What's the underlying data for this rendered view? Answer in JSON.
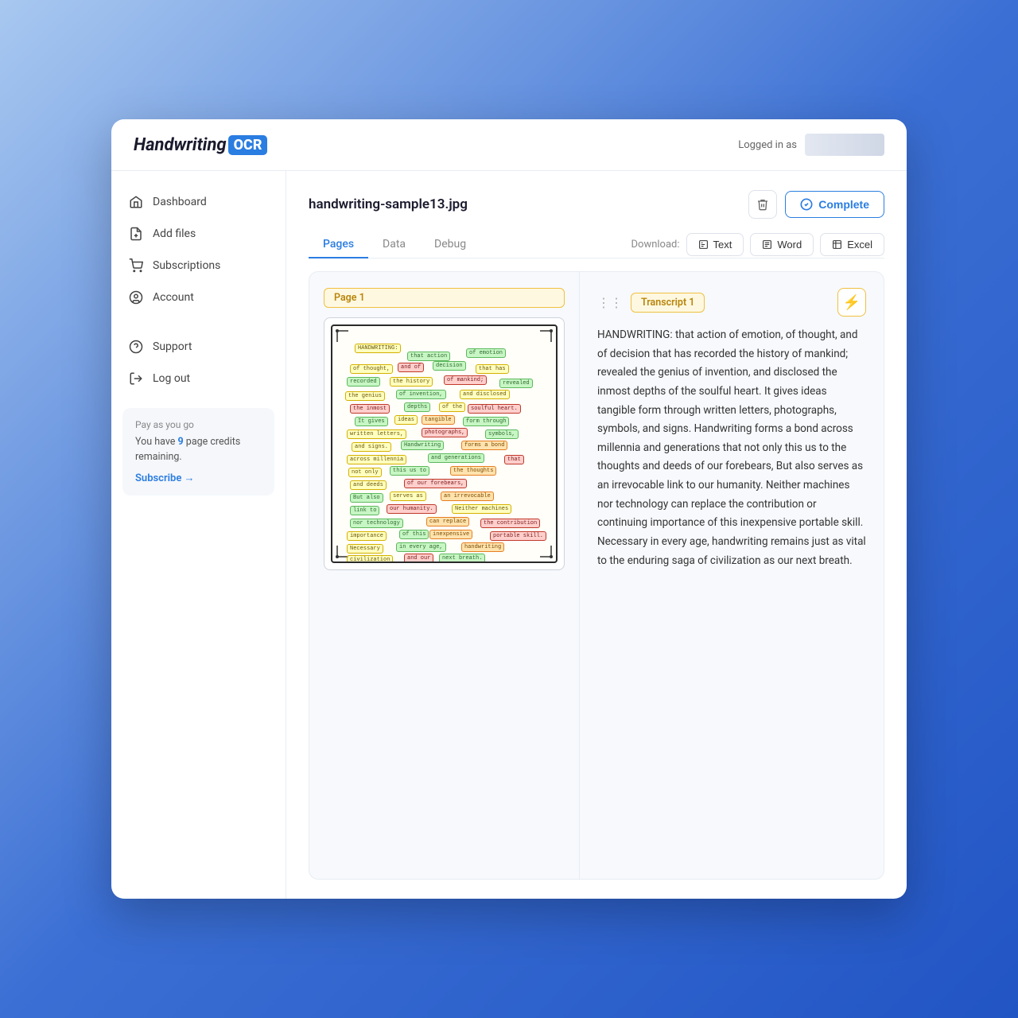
{
  "app": {
    "logo_text": "Handwriting",
    "logo_ocr": "OCR",
    "logged_in_label": "Logged in as"
  },
  "sidebar": {
    "items": [
      {
        "id": "dashboard",
        "label": "Dashboard",
        "icon": "home"
      },
      {
        "id": "add-files",
        "label": "Add files",
        "icon": "file-plus"
      },
      {
        "id": "subscriptions",
        "label": "Subscriptions",
        "icon": "shopping-cart"
      },
      {
        "id": "account",
        "label": "Account",
        "icon": "user-circle"
      },
      {
        "id": "support",
        "label": "Support",
        "icon": "help-circle"
      },
      {
        "id": "logout",
        "label": "Log out",
        "icon": "log-out"
      }
    ],
    "credits": {
      "title": "Pay as you go",
      "text_prefix": "You have ",
      "credits_count": "9",
      "text_suffix": " page credits remaining.",
      "subscribe_label": "Subscribe →"
    }
  },
  "file": {
    "name": "handwriting-sample13.jpg",
    "complete_label": "Complete",
    "delete_title": "Delete"
  },
  "tabs": [
    {
      "id": "pages",
      "label": "Pages",
      "active": true
    },
    {
      "id": "data",
      "label": "Data"
    },
    {
      "id": "debug",
      "label": "Debug"
    }
  ],
  "download": {
    "label": "Download:",
    "buttons": [
      {
        "id": "text",
        "label": "Text",
        "icon": "txt"
      },
      {
        "id": "word",
        "label": "Word",
        "icon": "doc"
      },
      {
        "id": "excel",
        "label": "Excel",
        "icon": "xls"
      }
    ]
  },
  "page": {
    "label": "Page 1",
    "transcript_label": "Transcript 1",
    "transcript_text": "HANDWRITING: that action of emotion, of thought, and of decision that has recorded the history of mankind; revealed the genius of invention, and disclosed the inmost depths of the soulful heart. It gives ideas tangible form through written letters, photographs, symbols, and signs. Handwriting forms a bond across millennia and generations that not only this us to the thoughts and deeds of our forebears, But also serves as an irrevocable link to our humanity. Neither machines nor technology can replace the contribution or continuing importance of this inexpensive portable skill. Necessary in every age, handwriting remains just as vital to the enduring saga of civilization as our next breath."
  }
}
